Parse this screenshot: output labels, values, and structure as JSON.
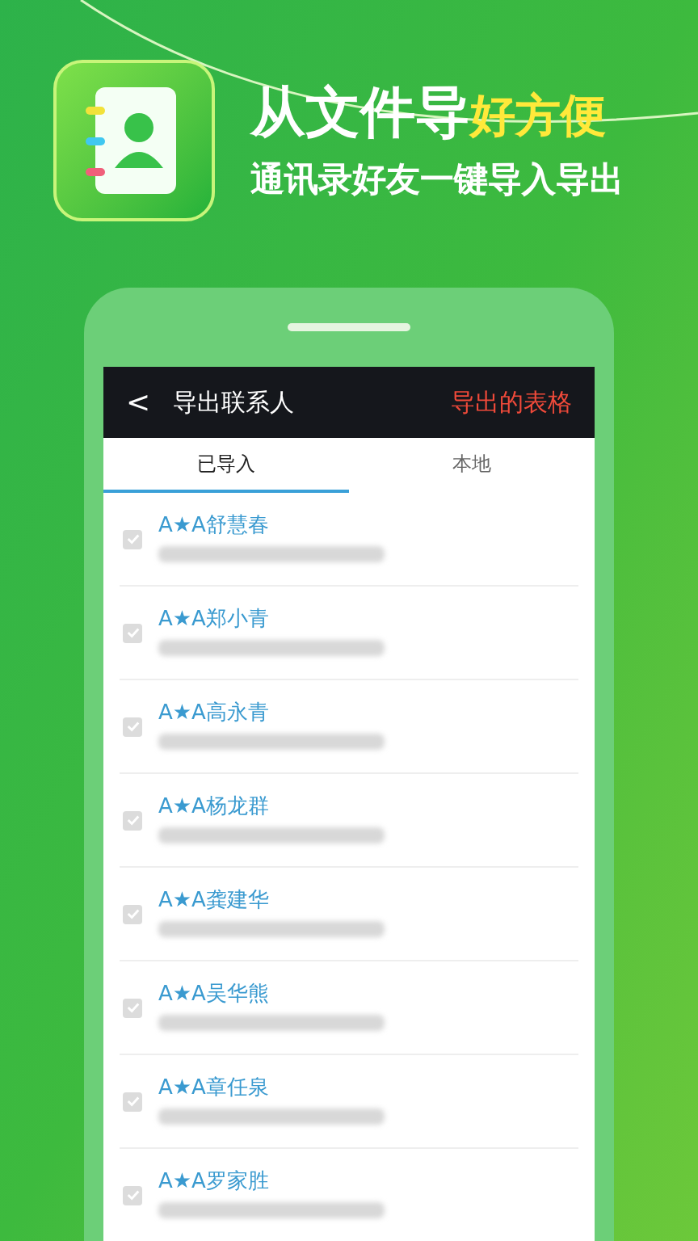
{
  "banner": {
    "title": "从文件导",
    "title_highlight": "好方便",
    "subtitle": "通讯录好友一键导入导出"
  },
  "header": {
    "back": "<",
    "title": "导出联系人",
    "action": "导出的表格"
  },
  "tabs": [
    {
      "label": "已导入",
      "selected": true
    },
    {
      "label": "本地",
      "selected": false
    }
  ],
  "contacts": [
    {
      "name": "A★A舒慧春",
      "checked": true
    },
    {
      "name": "A★A郑小青",
      "checked": true
    },
    {
      "name": "A★A高永青",
      "checked": true
    },
    {
      "name": "A★A杨龙群",
      "checked": true
    },
    {
      "name": "A★A龚建华",
      "checked": true
    },
    {
      "name": "A★A吴华熊",
      "checked": true
    },
    {
      "name": "A★A章任泉",
      "checked": true
    },
    {
      "name": "A★A罗家胜",
      "checked": true
    }
  ]
}
